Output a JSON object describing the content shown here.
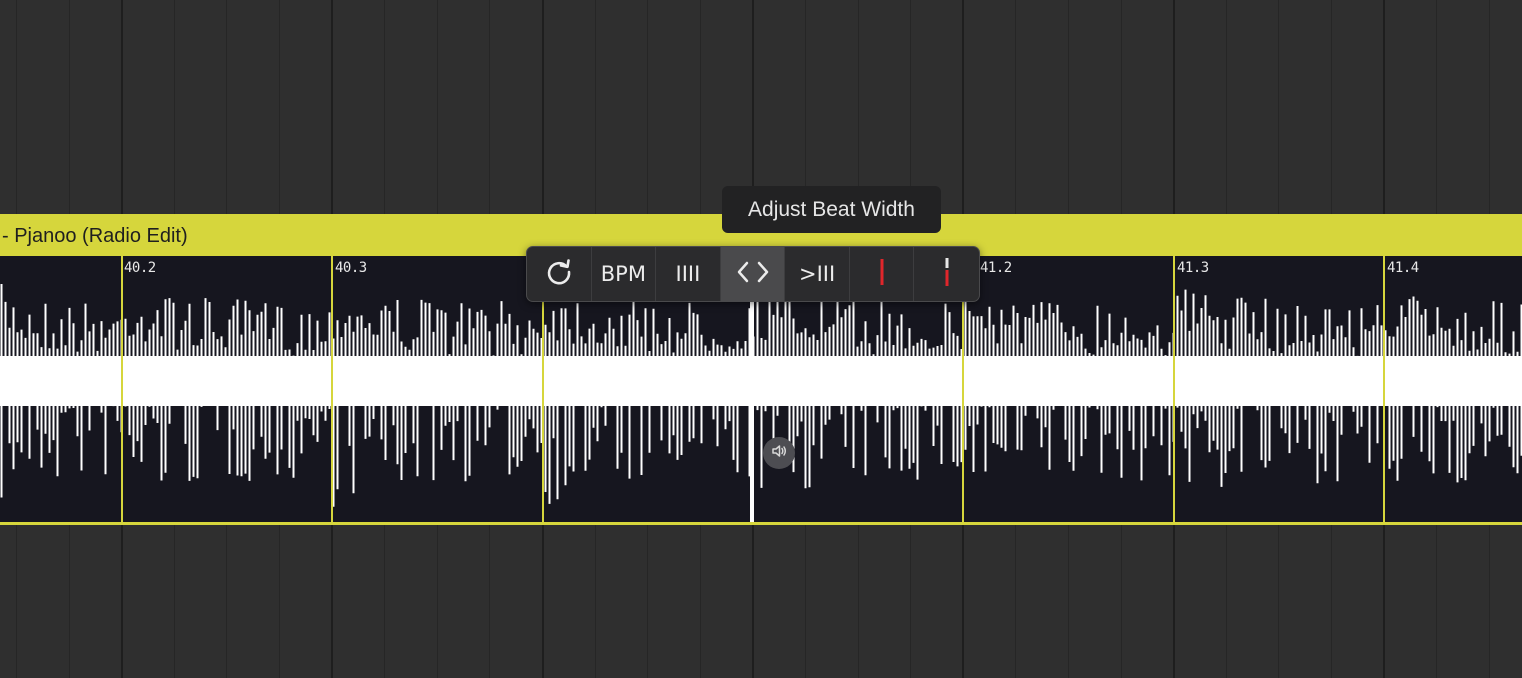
{
  "track": {
    "title": "- Pjanoo (Radio Edit)",
    "color": "#d6d63c"
  },
  "beat_labels": [
    "40.2",
    "40.3",
    "41.2",
    "41.3",
    "41.4"
  ],
  "toolbar": {
    "reset": {
      "icon": "refresh-icon"
    },
    "bpm_label": "BPM",
    "beat_grid_label": "IIII",
    "adjust_width": {
      "icon": "chevron-left-right-icon",
      "active": true
    },
    "shift_grid_label": ">III",
    "set_downbeat": {
      "icon": "red-marker-icon"
    },
    "set_cue": {
      "icon": "red-marker-dashed-icon"
    },
    "accent_color": "#e0262b"
  },
  "tooltip": {
    "text": "Adjust Beat Width"
  },
  "speaker": {
    "icon": "speaker-icon"
  }
}
